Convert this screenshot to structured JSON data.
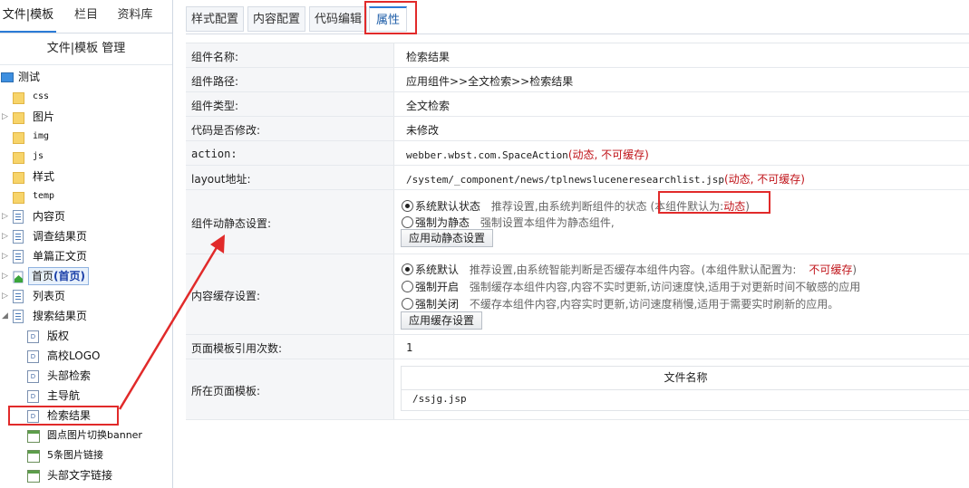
{
  "left_tabs": {
    "file": "文件|模板",
    "column": "栏目",
    "library": "资料库"
  },
  "manager_button": "文件|模板 管理",
  "tree": {
    "root": "测试",
    "css": "css",
    "pics": "图片",
    "img": "img",
    "js": "js",
    "style": "样式",
    "temp": "temp",
    "content_page": "内容页",
    "survey_page": "调查结果页",
    "single_page": "单篇正文页",
    "home_page": "首页",
    "home_page_tag": "(首页)",
    "list_page": "列表页",
    "search_page": "搜索结果页",
    "copyright": "版权",
    "logo": "高校LOGO",
    "head_search": "头部检索",
    "main_nav": "主导航",
    "search_result": "检索结果",
    "banner": "圆点图片切换banner",
    "five_links": "5条图片链接",
    "head_text_links": "头部文字链接"
  },
  "tabs": {
    "style": "样式配置",
    "content": "内容配置",
    "code": "代码编辑",
    "prop": "属性"
  },
  "props": {
    "name_key": "组件名称:",
    "name_val": "检索结果",
    "path_key": "组件路径:",
    "path_val": "应用组件>>全文检索>>检索结果",
    "type_key": "组件类型:",
    "type_val": "全文检索",
    "modified_key": "代码是否修改:",
    "modified_val": "未修改",
    "action_key": "action:",
    "action_val": "webber.wbst.com.SpaceAction",
    "action_note": "(动态, 不可缓存)",
    "layout_key": "layout地址:",
    "layout_val": "/system/_component/news/tplnewsluceneresearchlist.jsp",
    "layout_note": "(动态, 不可缓存)",
    "dyn_key": "组件动静态设置:",
    "dyn_opt1": "系统默认状态",
    "dyn_opt1_desc": "推荐设置,由系统判断组件的状态 (本组件默认为:",
    "dyn_opt1_value": "动态",
    "dyn_opt1_close": ")",
    "dyn_opt2": "强制为静态",
    "dyn_opt2_desc": "强制设置本组件为静态组件,",
    "dyn_button": "应用动静态设置",
    "cache_key": "内容缓存设置:",
    "cache_opt1": "系统默认",
    "cache_opt1_desc": "推荐设置,由系统智能判断是否缓存本组件内容。(本组件默认配置为:",
    "cache_opt1_value": "不可缓存",
    "cache_opt1_close": ")",
    "cache_opt2": "强制开启",
    "cache_opt2_desc": "强制缓存本组件内容,内容不实时更新,访问速度快,适用于对更新时间不敏感的应用",
    "cache_opt3": "强制关闭",
    "cache_opt3_desc": "不缓存本组件内容,内容实时更新,访问速度稍慢,适用于需要实时刷新的应用。",
    "cache_button": "应用缓存设置",
    "ref_key": "页面模板引用次数:",
    "ref_val": "1",
    "tpl_key": "所在页面模板:",
    "tpl_head": "文件名称",
    "tpl_file": "/ssjg.jsp"
  },
  "colors": {
    "accent": "#2b7bd6",
    "annotation": "#e12a2a",
    "status_red": "#c0141a"
  }
}
